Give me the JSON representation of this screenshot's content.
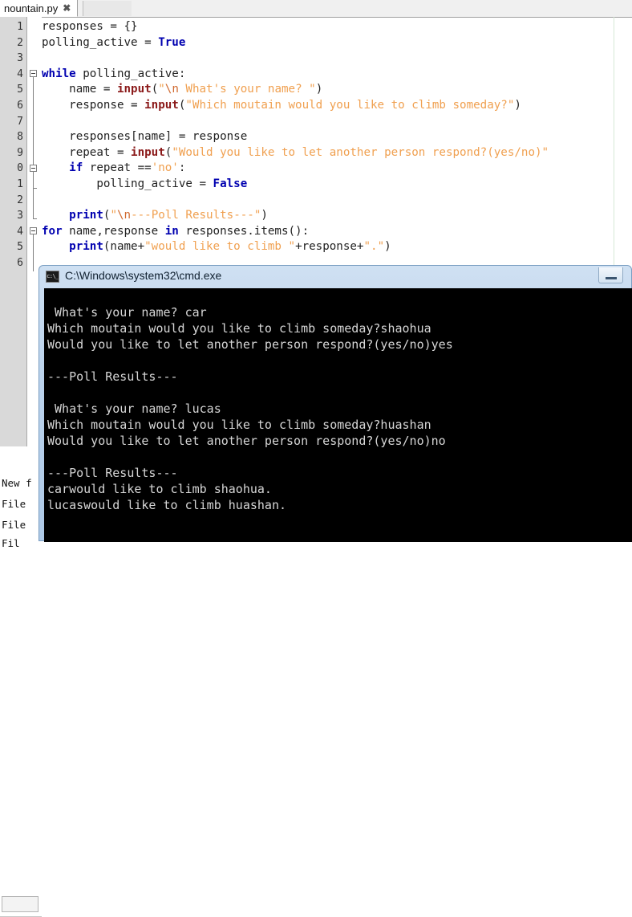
{
  "editor": {
    "tab": {
      "label": "nountain.py",
      "close_icon": "close-icon",
      "close_glyph": "✖"
    },
    "line_numbers": [
      "1",
      "2",
      "3",
      "4",
      "5",
      "6",
      "7",
      "8",
      "9",
      "0",
      "1",
      "2",
      "3",
      "4",
      "5",
      "6"
    ],
    "code_lines": [
      {
        "n": "1",
        "segments": [
          {
            "t": "responses = {}",
            "c": "pl"
          }
        ]
      },
      {
        "n": "2",
        "segments": [
          {
            "t": "polling_active = ",
            "c": "pl"
          },
          {
            "t": "True",
            "c": "kw"
          }
        ]
      },
      {
        "n": "3",
        "segments": [
          {
            "t": "",
            "c": "pl"
          }
        ]
      },
      {
        "n": "4",
        "segments": [
          {
            "t": "while",
            "c": "kw"
          },
          {
            "t": " polling_active:",
            "c": "pl"
          }
        ]
      },
      {
        "n": "5",
        "segments": [
          {
            "t": "    name = ",
            "c": "pl"
          },
          {
            "t": "input",
            "c": "bi"
          },
          {
            "t": "(",
            "c": "pl"
          },
          {
            "t": "\"",
            "c": "str"
          },
          {
            "t": "\\n",
            "c": "esc"
          },
          {
            "t": " What's your name? \"",
            "c": "str"
          },
          {
            "t": ")",
            "c": "pl"
          }
        ]
      },
      {
        "n": "6",
        "segments": [
          {
            "t": "    response = ",
            "c": "pl"
          },
          {
            "t": "input",
            "c": "bi"
          },
          {
            "t": "(",
            "c": "pl"
          },
          {
            "t": "\"Which moutain would you like to climb someday?\"",
            "c": "str"
          },
          {
            "t": ")",
            "c": "pl"
          }
        ]
      },
      {
        "n": "7",
        "segments": [
          {
            "t": "",
            "c": "pl"
          }
        ]
      },
      {
        "n": "8",
        "segments": [
          {
            "t": "    responses[name] = response",
            "c": "pl"
          }
        ]
      },
      {
        "n": "9",
        "segments": [
          {
            "t": "    repeat = ",
            "c": "pl"
          },
          {
            "t": "input",
            "c": "bi"
          },
          {
            "t": "(",
            "c": "pl"
          },
          {
            "t": "\"Would you like to let another person respond?(yes/no)\"",
            "c": "str"
          }
        ]
      },
      {
        "n": "10",
        "segments": [
          {
            "t": "    ",
            "c": "pl"
          },
          {
            "t": "if",
            "c": "kw"
          },
          {
            "t": " repeat ==",
            "c": "pl"
          },
          {
            "t": "'no'",
            "c": "str"
          },
          {
            "t": ":",
            "c": "pl"
          }
        ]
      },
      {
        "n": "11",
        "segments": [
          {
            "t": "        polling_active = ",
            "c": "pl"
          },
          {
            "t": "False",
            "c": "kw"
          }
        ]
      },
      {
        "n": "12",
        "segments": [
          {
            "t": "",
            "c": "pl"
          }
        ]
      },
      {
        "n": "13",
        "segments": [
          {
            "t": "    ",
            "c": "pl"
          },
          {
            "t": "print",
            "c": "kw"
          },
          {
            "t": "(",
            "c": "pl"
          },
          {
            "t": "\"",
            "c": "str"
          },
          {
            "t": "\\n",
            "c": "esc"
          },
          {
            "t": "---Poll Results---\"",
            "c": "str"
          },
          {
            "t": ")",
            "c": "pl"
          }
        ]
      },
      {
        "n": "14",
        "segments": [
          {
            "t": "for",
            "c": "kw"
          },
          {
            "t": " name,response ",
            "c": "pl"
          },
          {
            "t": "in",
            "c": "kw"
          },
          {
            "t": " responses.items",
            "c": "pl"
          },
          {
            "t": "()",
            "c": "pl"
          },
          {
            "t": ":",
            "c": "pl"
          }
        ]
      },
      {
        "n": "15",
        "segments": [
          {
            "t": "    ",
            "c": "pl"
          },
          {
            "t": "print",
            "c": "kw"
          },
          {
            "t": "(name+",
            "c": "pl"
          },
          {
            "t": "\"would like to climb \"",
            "c": "str"
          },
          {
            "t": "+response+",
            "c": "pl"
          },
          {
            "t": "\".\"",
            "c": "str"
          },
          {
            "t": ")",
            "c": "pl"
          }
        ]
      },
      {
        "n": "16",
        "segments": [
          {
            "t": "",
            "c": "pl"
          }
        ]
      }
    ],
    "lower_panel": {
      "items": [
        "New f",
        "File",
        "File",
        "Fil"
      ]
    }
  },
  "cmd": {
    "title": "C:\\Windows\\system32\\cmd.exe",
    "icon_label": "c:\\_",
    "minimize_label": "minimize",
    "output_lines": [
      "",
      " What's your name? car",
      "Which moutain would you like to climb someday?shaohua",
      "Would you like to let another person respond?(yes/no)yes",
      "",
      "---Poll Results---",
      "",
      " What's your name? lucas",
      "Which moutain would you like to climb someday?huashan",
      "Would you like to let another person respond?(yes/no)no",
      "",
      "---Poll Results---",
      "carwould like to climb shaohua.",
      "lucaswould like to climb huashan."
    ]
  },
  "colors": {
    "keyword": "#0000b0",
    "builtin": "#8b1a1a",
    "string": "#f0a050",
    "escape": "#d06a30",
    "console_bg": "#000000",
    "console_fg": "#d6d6d6",
    "titlebar": "#bcd3ec"
  }
}
